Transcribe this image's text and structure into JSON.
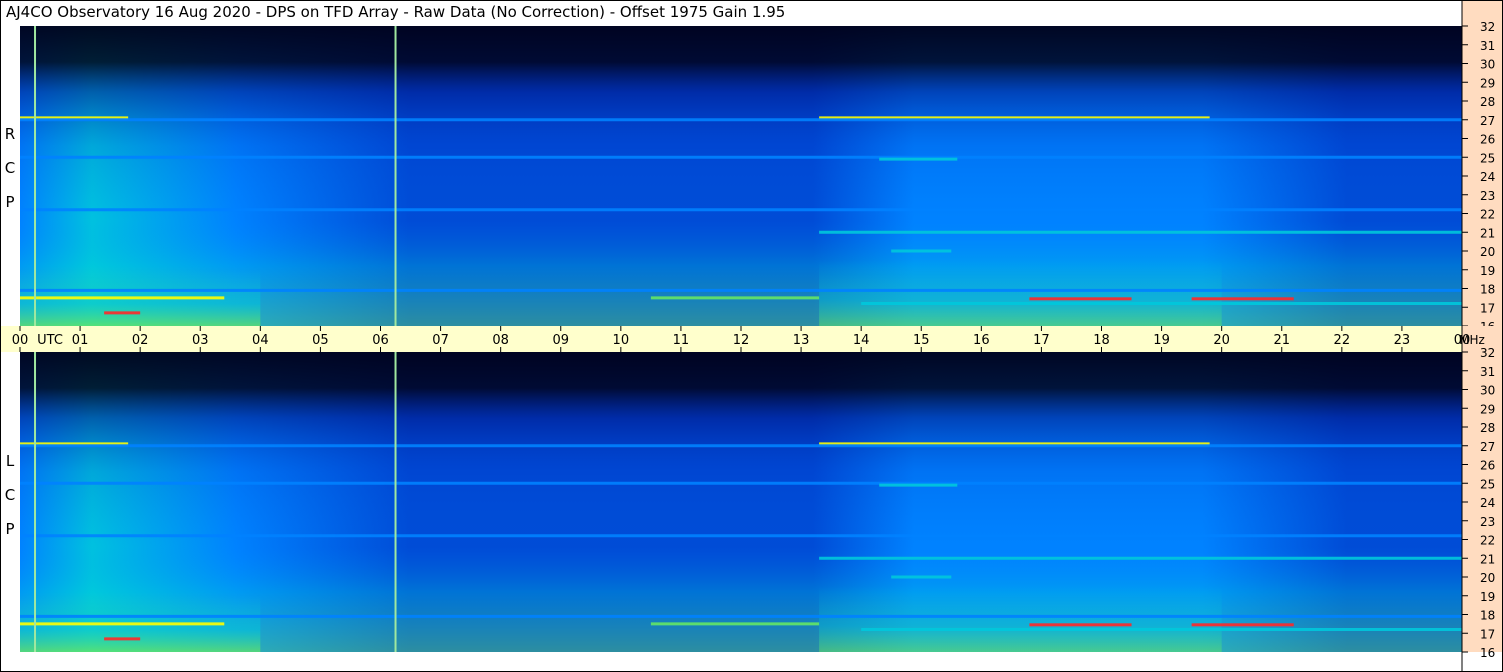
{
  "title": "AJ4CO Observatory  16 Aug 2020  -  DPS on TFD Array  -  Raw Data (No Correction)  -  Offset 1975  Gain 1.95",
  "panels": [
    {
      "id": "rcp",
      "label": [
        "R",
        "C",
        "P"
      ]
    },
    {
      "id": "lcp",
      "label": [
        "L",
        "C",
        "P"
      ]
    }
  ],
  "colors": {
    "time_axis_bg": "#ffffcc",
    "freq_axis_bg": "#ffdcc0",
    "black_sky": "#000018",
    "dark_blue": "#001a8c",
    "blue": "#0046d2",
    "light_blue": "#0082ff",
    "cyan": "#00c8dc",
    "green": "#64e664",
    "yellow": "#ffff00",
    "red": "#ff2828",
    "marker_line": "#a0e8a0"
  },
  "chart_data": {
    "type": "heatmap",
    "x_unit": "UTC",
    "y_unit": "MHz",
    "time_ticks": [
      "00",
      "01",
      "02",
      "03",
      "04",
      "05",
      "06",
      "07",
      "08",
      "09",
      "10",
      "11",
      "12",
      "13",
      "14",
      "15",
      "16",
      "17",
      "18",
      "19",
      "20",
      "21",
      "22",
      "23",
      "00"
    ],
    "xlim": [
      0,
      24
    ],
    "freq_ticks": [
      "16",
      "17",
      "18",
      "19",
      "20",
      "21",
      "22",
      "23",
      "24",
      "25",
      "26",
      "27",
      "28",
      "29",
      "30",
      "31",
      "32"
    ],
    "ylim": [
      16,
      32
    ],
    "vertical_markers_utc": [
      0.25,
      6.25
    ],
    "bands": [
      {
        "mhz": 27.1,
        "utc_start": 0.0,
        "utc_end": 1.8,
        "level": 0.82
      },
      {
        "mhz": 27.1,
        "utc_start": 13.3,
        "utc_end": 19.8,
        "level": 0.85
      },
      {
        "mhz": 27.0,
        "utc_start": 0.0,
        "utc_end": 24.0,
        "level": 0.4
      },
      {
        "mhz": 25.0,
        "utc_start": 0.0,
        "utc_end": 24.0,
        "level": 0.38
      },
      {
        "mhz": 21.0,
        "utc_start": 13.3,
        "utc_end": 24.0,
        "level": 0.6
      },
      {
        "mhz": 22.2,
        "utc_start": 0.0,
        "utc_end": 24.0,
        "level": 0.38
      },
      {
        "mhz": 17.5,
        "utc_start": 0.0,
        "utc_end": 3.4,
        "level": 0.88
      },
      {
        "mhz": 17.5,
        "utc_start": 10.5,
        "utc_end": 13.3,
        "level": 0.72
      },
      {
        "mhz": 17.2,
        "utc_start": 14.0,
        "utc_end": 24.0,
        "level": 0.55
      },
      {
        "mhz": 17.9,
        "utc_start": 0.0,
        "utc_end": 24.0,
        "level": 0.48
      },
      {
        "mhz": 17.45,
        "utc_start": 16.8,
        "utc_end": 18.5,
        "level": 0.96
      },
      {
        "mhz": 17.45,
        "utc_start": 19.5,
        "utc_end": 21.2,
        "level": 0.96
      },
      {
        "mhz": 16.7,
        "utc_start": 1.4,
        "utc_end": 2.0,
        "level": 0.98
      },
      {
        "mhz": 24.9,
        "utc_start": 14.3,
        "utc_end": 15.6,
        "level": 0.55
      },
      {
        "mhz": 20.0,
        "utc_start": 14.5,
        "utc_end": 15.5,
        "level": 0.55
      }
    ]
  }
}
